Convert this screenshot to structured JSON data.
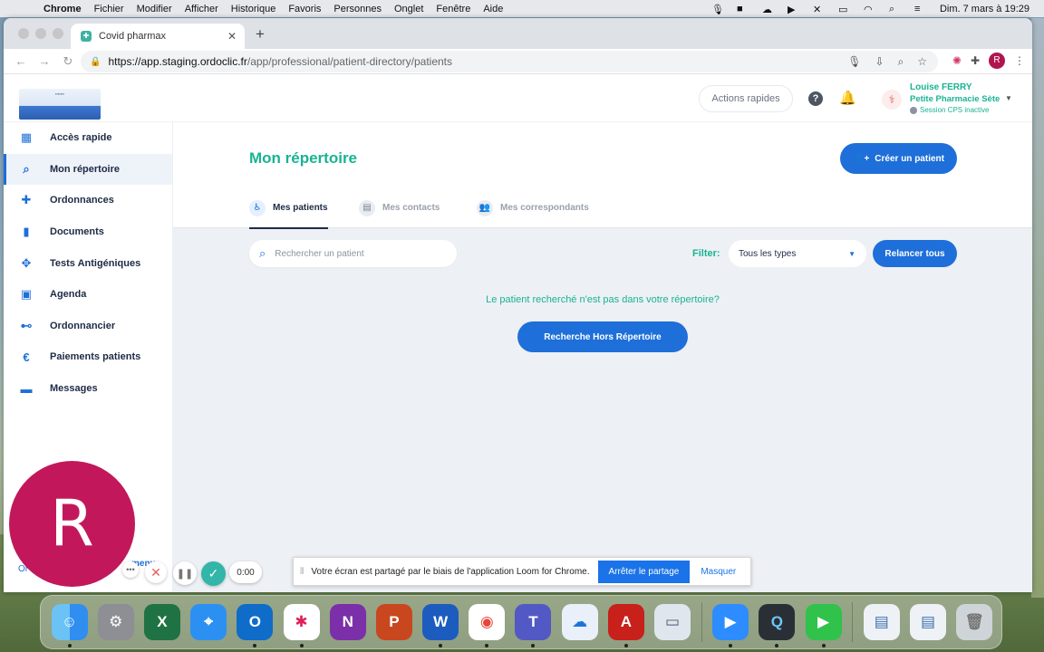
{
  "menubar": {
    "app": "Chrome",
    "items": [
      "Fichier",
      "Modifier",
      "Afficher",
      "Historique",
      "Favoris",
      "Personnes",
      "Onglet",
      "Fenêtre",
      "Aide"
    ],
    "datetime": "Dim. 7 mars à  19:29"
  },
  "browser": {
    "tab_title": "Covid pharmax",
    "url_host": "https://app.staging.ordoclic.fr",
    "url_path": "/app/professional/patient-directory/patients",
    "profile_initial": "R"
  },
  "header": {
    "quick_actions": "Actions rapides",
    "help_glyph": "?",
    "user_name": "Louise FERRY",
    "pharmacy": "Petite Pharmacie Sète",
    "session_status": "Session CPS inactive"
  },
  "sidebar": {
    "items": [
      {
        "label": "Accès rapide",
        "icon": "qr-icon"
      },
      {
        "label": "Mon répertoire",
        "icon": "directory-icon"
      },
      {
        "label": "Ordonnances",
        "icon": "prescription-icon"
      },
      {
        "label": "Documents",
        "icon": "document-icon"
      },
      {
        "label": "Tests Antigéniques",
        "icon": "test-icon"
      },
      {
        "label": "Agenda",
        "icon": "calendar-icon"
      },
      {
        "label": "Ordonnancier",
        "icon": "toggle-icon"
      },
      {
        "label": "Paiements patients",
        "icon": "euro-icon"
      },
      {
        "label": "Messages",
        "icon": "message-icon"
      }
    ],
    "menu_link": "menu",
    "bottom_link": "Or"
  },
  "main": {
    "title": "Mon répertoire",
    "create_button": "Créer un patient",
    "tabs": [
      "Mes patients",
      "Mes contacts",
      "Mes correspondants"
    ],
    "search_placeholder": "Rechercher un patient",
    "filter_label": "Filter:",
    "filter_value": "Tous les types",
    "relaunch_button": "Relancer tous",
    "not_found_text": "Le patient recherché n'est pas dans votre répertoire?",
    "search_outside_button": "Recherche Hors Répertoire"
  },
  "loom": {
    "bubble_initial": "R",
    "timer": "0:00"
  },
  "share_bar": {
    "message": "Votre écran est partagé par le biais de l'application Loom for Chrome.",
    "stop_button": "Arrêter le partage",
    "hide_link": "Masquer"
  },
  "colors": {
    "accent_blue": "#1e6fd9",
    "accent_green": "#19b394",
    "loom_bubble": "#c2185b"
  }
}
